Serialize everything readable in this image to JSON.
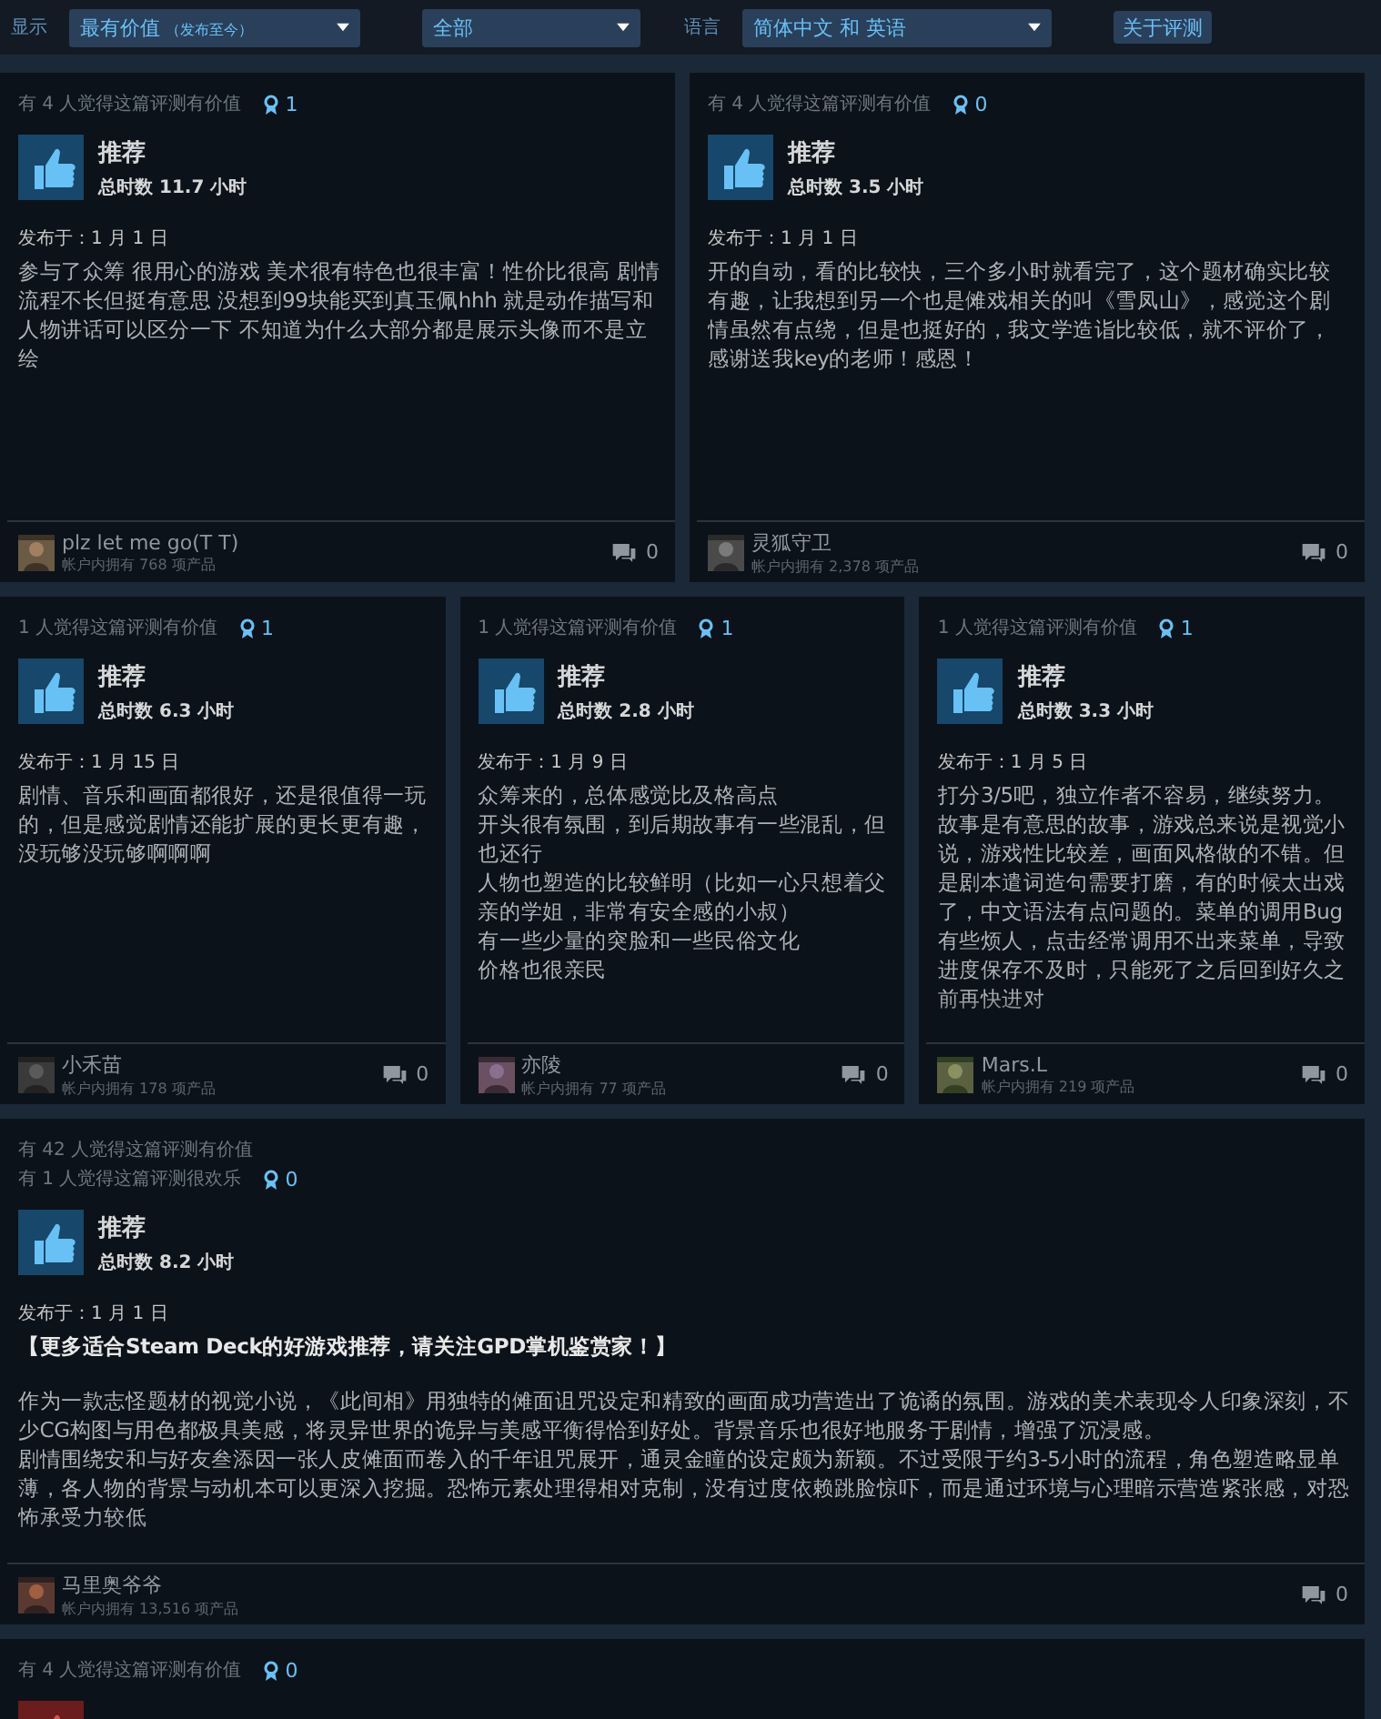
{
  "filters": [
    {
      "label": "显示",
      "value": "最有价值",
      "note": "（发布至今）"
    },
    {
      "value": "全部"
    },
    {
      "label": "语言",
      "value": "简体中文 和 英语"
    }
  ],
  "about_button": "关于评测",
  "review_rows": [
    [
      {
        "helpful": [
          "有 4 人觉得这篇评测有价值"
        ],
        "awards": "1",
        "recommended": true,
        "verdict": "推荐",
        "hours": "总时数 11.7 小时",
        "posted": "发布于：1 月 1 日",
        "paragraphs": [
          {
            "kind": "plain",
            "text": "参与了众筹 很用心的游戏 美术很有特色也很丰富！性价比很高 剧情流程不长但挺有意思 没想到99块能买到真玉佩hhh 就是动作描写和人物讲话可以区分一下 不知道为什么大部分都是展示头像而不是立绘"
          }
        ],
        "author": {
          "name": "plz let me go(T T)",
          "products": "帐户内拥有 768 项产品"
        },
        "comments": "0"
      },
      {
        "helpful": [
          "有 4 人觉得这篇评测有价值"
        ],
        "awards": "0",
        "recommended": true,
        "verdict": "推荐",
        "hours": "总时数 3.5 小时",
        "posted": "发布于：1 月 1 日",
        "paragraphs": [
          {
            "kind": "plain",
            "text": "开的自动，看的比较快，三个多小时就看完了，这个题材确实比较有趣，让我想到另一个也是傩戏相关的叫《雪凤山》，感觉这个剧情虽然有点绕，但是也挺好的，我文学造诣比较低，就不评价了，感谢送我key的老师！感恩！"
          }
        ],
        "author": {
          "name": "灵狐守卫",
          "products": "帐户内拥有 2,378 项产品"
        },
        "comments": "0"
      }
    ],
    [
      {
        "helpful": [
          "1 人觉得这篇评测有价值"
        ],
        "awards": "1",
        "recommended": true,
        "verdict": "推荐",
        "hours": "总时数 6.3 小时",
        "posted": "发布于：1 月 15 日",
        "paragraphs": [
          {
            "kind": "plain",
            "text": "剧情、音乐和画面都很好，还是很值得一玩的，但是感觉剧情还能扩展的更长更有趣，没玩够没玩够啊啊啊"
          }
        ],
        "author": {
          "name": "小禾苗",
          "products": "帐户内拥有 178 项产品"
        },
        "comments": "0"
      },
      {
        "helpful": [
          "1 人觉得这篇评测有价值"
        ],
        "awards": "1",
        "recommended": true,
        "verdict": "推荐",
        "hours": "总时数 2.8 小时",
        "posted": "发布于：1 月 9 日",
        "paragraphs": [
          {
            "kind": "plain",
            "text": "众筹来的，总体感觉比及格高点"
          },
          {
            "kind": "plain",
            "text": "开头很有氛围，到后期故事有一些混乱，但也还行"
          },
          {
            "kind": "plain",
            "text": "人物也塑造的比较鲜明（比如一心只想着父亲的学姐，非常有安全感的小叔）"
          },
          {
            "kind": "plain",
            "text": "有一些少量的突脸和一些民俗文化"
          },
          {
            "kind": "plain",
            "text": "价格也很亲民"
          }
        ],
        "author": {
          "name": "亦陵",
          "products": "帐户内拥有 77 项产品"
        },
        "comments": "0"
      },
      {
        "helpful": [
          "1 人觉得这篇评测有价值"
        ],
        "awards": "1",
        "recommended": true,
        "verdict": "推荐",
        "hours": "总时数 3.3 小时",
        "posted": "发布于：1 月 5 日",
        "paragraphs": [
          {
            "kind": "plain",
            "text": "打分3/5吧，独立作者不容易，继续努力。"
          },
          {
            "kind": "plain",
            "text": "故事是有意思的故事，游戏总来说是视觉小说，游戏性比较差，画面风格做的不错。但是剧本遣词造句需要打磨，有的时候太出戏了，中文语法有点问题的。菜单的调用Bug有些烦人，点击经常调用不出来菜单，导致进度保存不及时，只能死了之后回到好久之前再快进对"
          }
        ],
        "author": {
          "name": "Mars.L",
          "products": "帐户内拥有 219 项产品"
        },
        "comments": "0"
      }
    ],
    [
      {
        "helpful": [
          "有 42 人觉得这篇评测有价值",
          "有 1 人觉得这篇评测很欢乐"
        ],
        "awards": "0",
        "recommended": true,
        "verdict": "推荐",
        "hours": "总时数 8.2 小时",
        "posted": "发布于：1 月 1 日",
        "paragraphs": [
          {
            "kind": "strong",
            "text": "【更多适合Steam Deck的好游戏推荐，请关注GPD掌机鉴赏家！】"
          },
          {
            "kind": "plain",
            "text": "作为一款志怪题材的视觉小说，《此间相》用独特的傩面诅咒设定和精致的画面成功营造出了诡谲的氛围。游戏的美术表现令人印象深刻，不少CG构图与用色都极具美感，将灵异世界的诡异与美感平衡得恰到好处。背景音乐也很好地服务于剧情，增强了沉浸感。"
          },
          {
            "kind": "plain",
            "text": "剧情围绕安和与好友叁添因一张人皮傩面而卷入的千年诅咒展开，通灵金瞳的设定颇为新颖。不过受限于约3-5小时的流程，角色塑造略显单薄，各人物的背景与动机本可以更深入挖掘。恐怖元素处理得相对克制，没有过度依赖跳脸惊吓，而是通过环境与心理暗示营造紧张感，对恐怖承受力较低"
          }
        ],
        "author": {
          "name": "马里奥爷爷",
          "products": "帐户内拥有 13,516 项产品"
        },
        "comments": "0"
      }
    ],
    [
      {
        "helpful": [
          "有 4 人觉得这篇评测有价值"
        ],
        "awards": "0",
        "recommended": false
      }
    ]
  ]
}
